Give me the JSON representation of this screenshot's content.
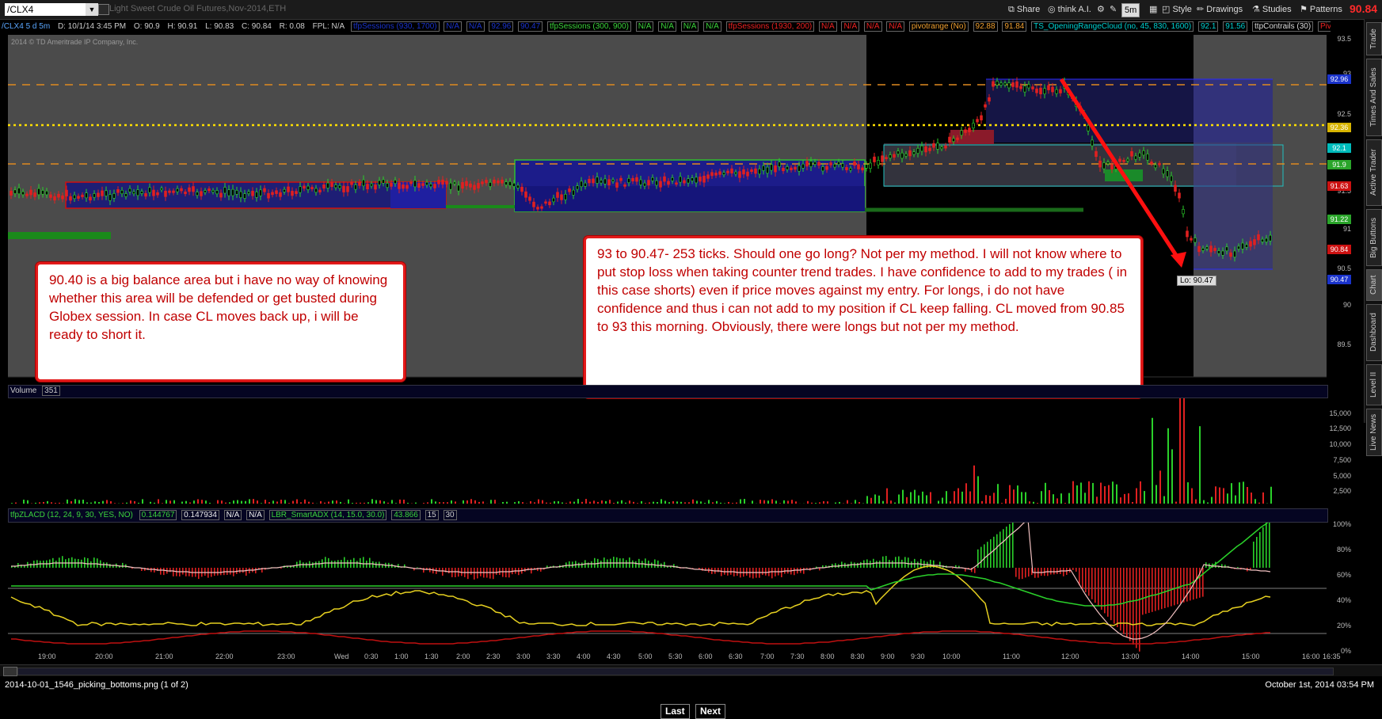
{
  "toolbar": {
    "symbol": "/CLX4",
    "instrument_name": "Light Sweet Crude Oil Futures,Nov-2014,ETH",
    "share": "Share",
    "think": "think A.I.",
    "timeframe": "5m",
    "style": "Style",
    "drawings": "Drawings",
    "studies": "Studies",
    "patterns": "Patterns",
    "last_price": "90.84"
  },
  "infobar": {
    "symbol_period": "/CLX4 5 d 5m",
    "date": "D: 10/1/14 3:45 PM",
    "open": "O: 90.9",
    "high": "H: 90.91",
    "low": "L: 90.83",
    "close": "C: 90.84",
    "range": "R: 0.08",
    "fpl": "FPL: N/A",
    "tfp1": "tfpSessions (930, 1700)",
    "na1": "N/A",
    "na2": "N/A",
    "v1": "92.96",
    "v2": "90.47",
    "tfp2": "tfpSessions (300, 900)",
    "na3": "N/A",
    "na4": "N/A",
    "na5": "N/A",
    "na6": "N/A",
    "tfp3": "tfpSessions (1930, 200)",
    "na7": "N/A",
    "na8": "N/A",
    "na9": "N/A",
    "na10": "N/A",
    "pivot": "pivotrange (No)",
    "p1": "92.88",
    "p2": "91.84",
    "orc": "TS_OpeningRangeCloud (no, 45, 830, 1600)",
    "o1": "92.1",
    "o2": "91.56",
    "contrails": "ttpContrails (30)",
    "pp": "PivotPoints (no, DAY)"
  },
  "copyright": "2014 © TD Ameritrade IP Company, Inc.",
  "side_tabs": [
    "Trade",
    "Times And Sales",
    "Active Trader",
    "Big Buttons",
    "Chart",
    "Dashboard",
    "Level II",
    "Live News"
  ],
  "price_axis": [
    "93.5",
    "93",
    "92.5",
    "92",
    "91.5",
    "91",
    "90.5",
    "90",
    "89.5"
  ],
  "price_tags": [
    {
      "label": "92.96",
      "color": "#1a33cc"
    },
    {
      "label": "92.36",
      "color": "#d7b400"
    },
    {
      "label": "92.1",
      "color": "#00bcbc"
    },
    {
      "label": "91.9",
      "color": "#2aa52a"
    },
    {
      "label": "91.63",
      "color": "#cc1111"
    },
    {
      "label": "91.22",
      "color": "#2aa52a"
    },
    {
      "label": "90.84",
      "color": "#cc1111"
    },
    {
      "label": "90.47",
      "color": "#1a33cc"
    }
  ],
  "notes": {
    "left": "90.40 is a big balance area but i have no way of knowing whether this area will be defended or get busted during Globex session. In case CL moves back up, i will be ready to short it.",
    "right": "93 to 90.47- 253 ticks. Should one go long? Not per my method. I will not know where to put stop loss when taking counter trend trades. I have confidence to add to my trades ( in this case shorts) even if price moves against my entry. For longs, i do not have confidence and thus i can not add to my position if CL keep falling.  CL moved from 90.85 to 93 this morning. Obviously, there were longs but not per my method."
  },
  "low_label": "Lo: 90.47",
  "volume": {
    "title": "Volume",
    "value": "351",
    "axis": [
      "15,000",
      "12,500",
      "10,000",
      "7,500",
      "5,000",
      "2,500"
    ]
  },
  "indicator": {
    "zlacd": "tfpZLACD (12, 24, 9, 30, YES, NO)",
    "z1": "0.144767",
    "z2": "0.147934",
    "na1": "N/A",
    "na2": "N/A",
    "adx": "LBR_SmartADX (14, 15.0, 30.0)",
    "adx_val": "43.866",
    "a1": "15",
    "a2": "30",
    "axis": [
      "100%",
      "80%",
      "60%",
      "40%",
      "20%",
      "0%"
    ]
  },
  "time_axis": [
    "19:00",
    "20:00",
    "21:00",
    "22:00",
    "23:00",
    "Wed",
    "0:30",
    "1:00",
    "1:30",
    "2:00",
    "2:30",
    "3:00",
    "3:30",
    "4:00",
    "4:30",
    "5:00",
    "5:30",
    "6:00",
    "6:30",
    "7:00",
    "7:30",
    "8:00",
    "8:30",
    "9:00",
    "9:30",
    "10:00",
    "11:00",
    "12:00",
    "13:00",
    "14:00",
    "15:00",
    "16:00",
    "16:35"
  ],
  "status": {
    "filename": "2014-10-01_1546_picking_bottoms.png (1 of 2)",
    "datetime": "October 1st, 2014 03:54 PM"
  },
  "nav": {
    "last": "Last",
    "next": "Next"
  }
}
